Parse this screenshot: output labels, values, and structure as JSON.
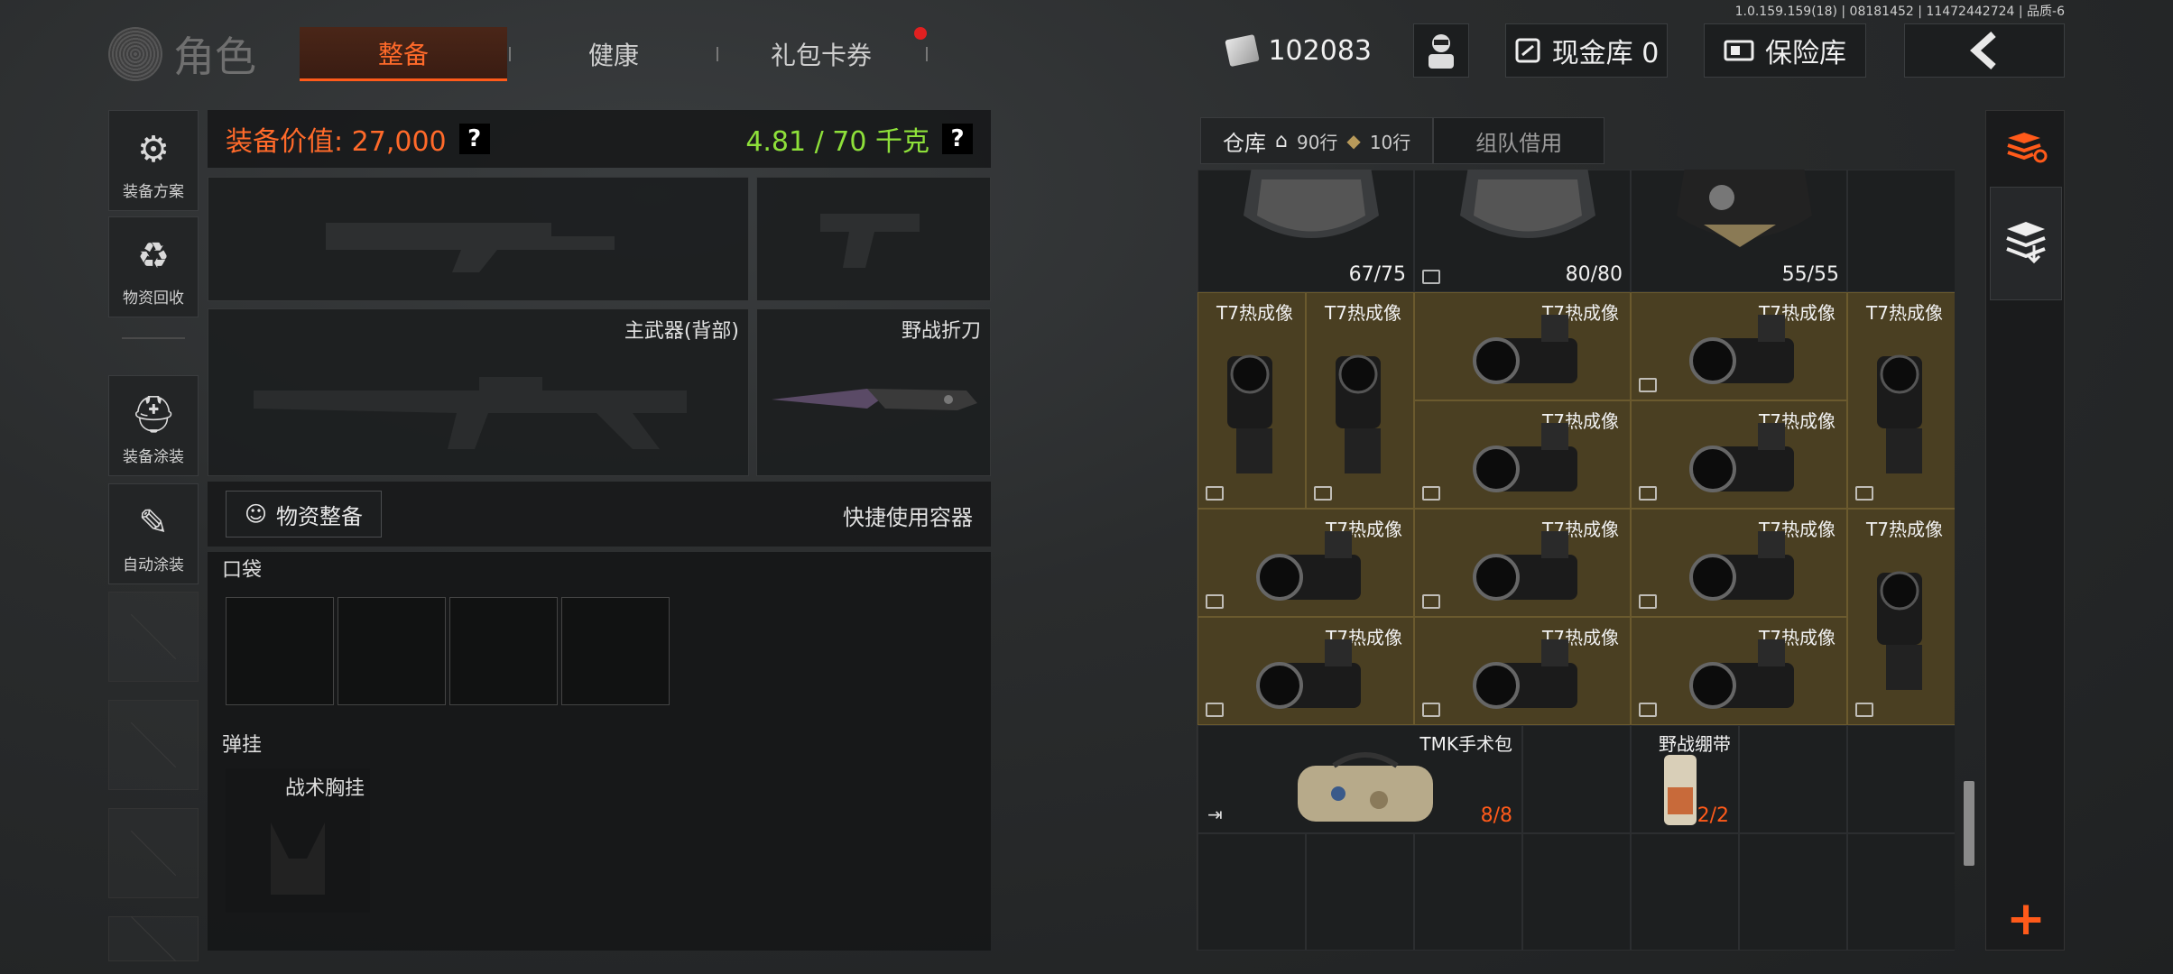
{
  "version_text": "1.0.159.159(18) | 08181452 | 11472442724 | 品质-6",
  "header": {
    "role_title": "角色",
    "tabs": [
      {
        "label": "整备",
        "active": true
      },
      {
        "label": "健康",
        "active": false
      },
      {
        "label": "礼包卡券",
        "active": false,
        "badge": true
      }
    ],
    "currency_value": "102083",
    "cash_vault_label": "现金库 0",
    "insurance_vault_label": "保险库",
    "back_icon": "chevron-left-icon"
  },
  "sidebar": {
    "items": [
      {
        "label": "装备方案",
        "icon": "gun-preset-icon"
      },
      {
        "label": "物资回收",
        "icon": "recycle-icon"
      },
      {
        "label": "装备涂装",
        "icon": "helmet-paint-icon"
      },
      {
        "label": "自动涂装",
        "icon": "brush-gear-icon"
      }
    ]
  },
  "loadout": {
    "value_label": "装备价值: 27,000",
    "value_help": "?",
    "weight_label": "4.81 / 70 千克",
    "weight_help": "?",
    "primary_back_label": "主武器(背部)",
    "knife_label": "野战折刀",
    "supply_button_label": "物资整备",
    "quick_container_label": "快捷使用容器",
    "pocket_label": "口袋",
    "rig_section_label": "弹挂",
    "rig_slot_label": "战术胸挂"
  },
  "storage": {
    "tabs": [
      {
        "label": "仓库",
        "icons": [
          "home-icon",
          "bag-icon"
        ],
        "extra": [
          "90行",
          "10行"
        ]
      },
      {
        "label": "组队借用"
      }
    ],
    "helmets": [
      {
        "count": "67/75"
      },
      {
        "count": "80/80"
      },
      {
        "count": "55/55"
      }
    ],
    "thermal_name": "T7热成像",
    "medkit": {
      "name": "TMK手术包",
      "count": "8/8"
    },
    "bandage": {
      "name": "野战绷带",
      "count": "2/2"
    }
  },
  "colors": {
    "accent": "#ff5a1a",
    "weight_green": "#8ee03a",
    "thermal_cell": "#4a3f22"
  }
}
